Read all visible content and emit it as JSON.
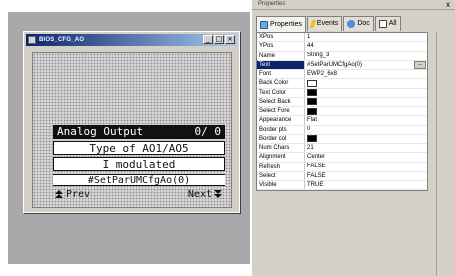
{
  "window": {
    "title": "BIOS_CFG_AO",
    "min": "_",
    "max": "□",
    "close": "×"
  },
  "lcd": {
    "header_left": "Analog Output",
    "header_right": "0/ 0",
    "type_line": "Type of AO1/AO5",
    "mod_line": "I modulated",
    "func_line": "#SetParUMCfgAo(0)",
    "prev": "Prev",
    "next": "Next"
  },
  "panel": {
    "header": "Properties",
    "close": "x",
    "tabs": [
      {
        "label": "Properties",
        "icon": "properties-icon"
      },
      {
        "label": "Events",
        "icon": "events-icon"
      },
      {
        "label": "Doc",
        "icon": "doc-icon"
      },
      {
        "label": "All",
        "icon": "all-icon"
      }
    ],
    "rows": [
      {
        "name": "XPos",
        "value": "1"
      },
      {
        "name": "YPos",
        "value": "44"
      },
      {
        "name": "Name",
        "value": "String_3"
      },
      {
        "name": "Text",
        "value": "#SetParUMCfgAo(0)"
      },
      {
        "name": "Font",
        "value": "EWP2_6x8"
      },
      {
        "name": "Back Color",
        "value": ""
      },
      {
        "name": "Text Color",
        "value": ""
      },
      {
        "name": "Select Back",
        "value": ""
      },
      {
        "name": "Select Fore",
        "value": ""
      },
      {
        "name": "Appearance",
        "value": "Flat"
      },
      {
        "name": "Border pts",
        "value": "0"
      },
      {
        "name": "Border col",
        "value": ""
      },
      {
        "name": "Num Chars",
        "value": "21"
      },
      {
        "name": "Alignment",
        "value": "Center"
      },
      {
        "name": "Refresh",
        "value": "FALSE"
      },
      {
        "name": "Select",
        "value": "FALSE"
      },
      {
        "name": "Visible",
        "value": "TRUE"
      }
    ],
    "ellipsis": "..."
  },
  "colors": {
    "lcd_dark": "#111111",
    "selection": "#0a246a",
    "title_bar": "#0a246a",
    "canvas_gray": "#a9a9a9"
  }
}
